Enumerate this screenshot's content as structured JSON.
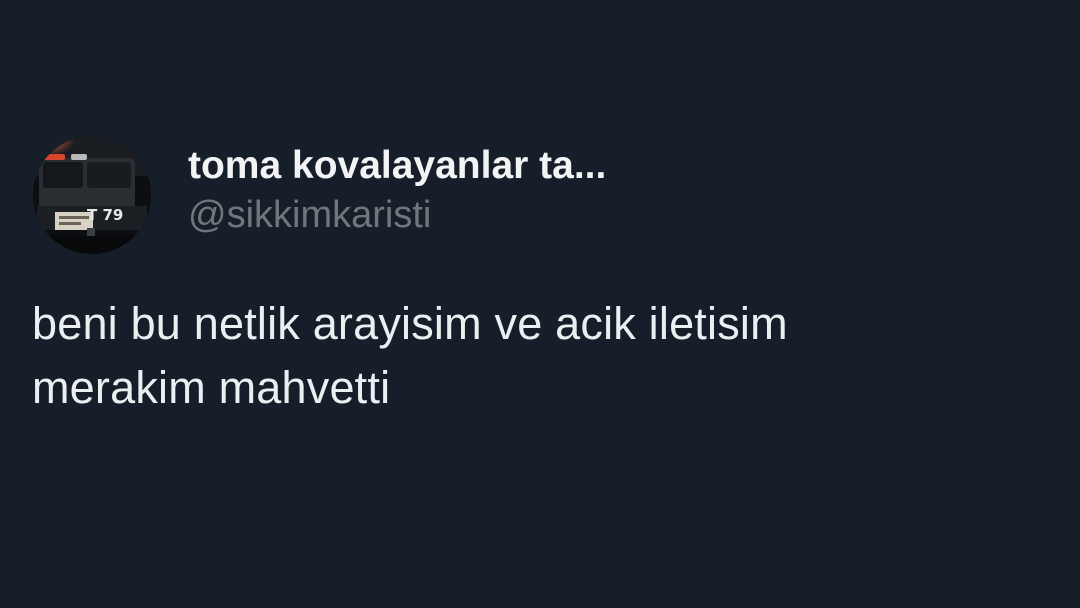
{
  "tweet": {
    "author": {
      "display_name": "toma kovalayanlar ta...",
      "handle": "@sikkimkaristi",
      "avatar_icon": "toma-vehicle-avatar",
      "avatar_plate_text": "T 79"
    },
    "text_lines": [
      "beni bu netlik arayisim ve acik iletisim",
      "merakim mahvetti"
    ]
  },
  "colors": {
    "background": "#161e29",
    "text_primary": "#eceff1",
    "text_secondary": "#71767b"
  }
}
